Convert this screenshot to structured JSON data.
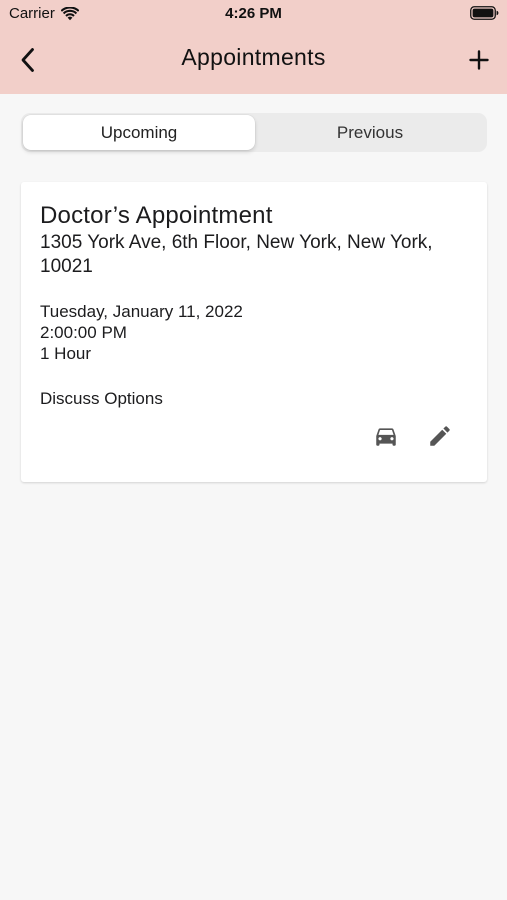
{
  "status_bar": {
    "carrier": "Carrier",
    "time": "4:26 PM"
  },
  "nav": {
    "title": "Appointments",
    "back_icon": "chevron-left-icon",
    "add_icon": "plus-icon"
  },
  "segments": [
    {
      "label": "Upcoming",
      "selected": true
    },
    {
      "label": "Previous",
      "selected": false
    }
  ],
  "appointment": {
    "title": "Doctor’s Appointment",
    "address": "1305 York Ave, 6th Floor, New York, New York, 10021",
    "date": "Tuesday, January 11, 2022",
    "time": "2:00:00 PM",
    "duration": "1 Hour",
    "notes": "Discuss Options",
    "actions": [
      "car-icon",
      "pencil-icon"
    ]
  },
  "colors": {
    "header_bg": "#f2cfc9",
    "page_bg": "#f7f7f7",
    "segment_bg": "#ebebeb",
    "icon_gray": "#555555"
  }
}
